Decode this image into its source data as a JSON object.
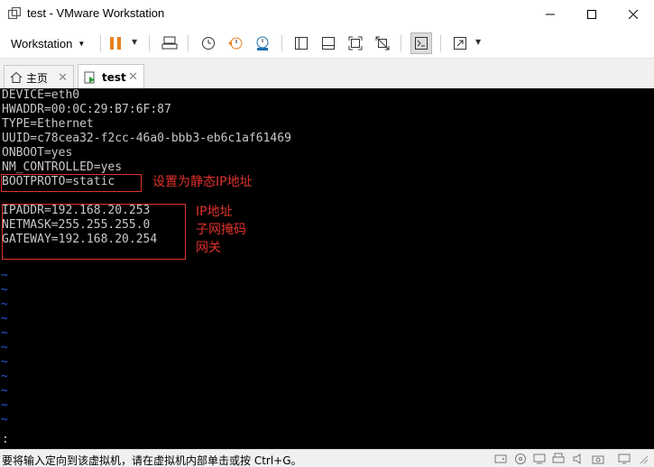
{
  "window": {
    "title": "test - VMware Workstation",
    "controls": [
      "minimize",
      "maximize",
      "close"
    ]
  },
  "toolbar": {
    "menu_label": "Workstation",
    "icons": [
      "pause-icon",
      "send-keys-icon",
      "snapshot-icon",
      "revert-snapshot-icon",
      "snapshot-manager-icon",
      "show-library-icon",
      "thumbnail-icon",
      "fit-guest-icon",
      "no-stretch-icon",
      "console-view-icon",
      "fullscreen-icon"
    ]
  },
  "tabs": [
    {
      "label": "主页",
      "active": false
    },
    {
      "label": "test",
      "active": true
    }
  ],
  "console": {
    "lines": [
      "DEVICE=eth0",
      "HWADDR=00:0C:29:B7:6F:87",
      "TYPE=Ethernet",
      "UUID=c78cea32-f2cc-46a0-bbb3-eb6c1af61469",
      "ONBOOT=yes",
      "NM_CONTROLLED=yes",
      "BOOTPROTO=static",
      "",
      "IPADDR=192.168.20.253",
      "NETMASK=255.255.255.0",
      "GATEWAY=192.168.20.254"
    ],
    "tilde": "~",
    "prompt": ":"
  },
  "annotations": {
    "bootproto_note": "设置为静态IP地址",
    "ip_note": "IP地址",
    "netmask_note": "子网掩码",
    "gateway_note": "网关"
  },
  "statusbar": {
    "text": "要将输入定向到该虚拟机，请在虚拟机内部单击或按 Ctrl+G。"
  },
  "colors": {
    "annotation_red": "#e0322b",
    "console_bg": "#000000",
    "tilde_blue": "#2a5adf",
    "pause_orange": "#e8801a"
  }
}
